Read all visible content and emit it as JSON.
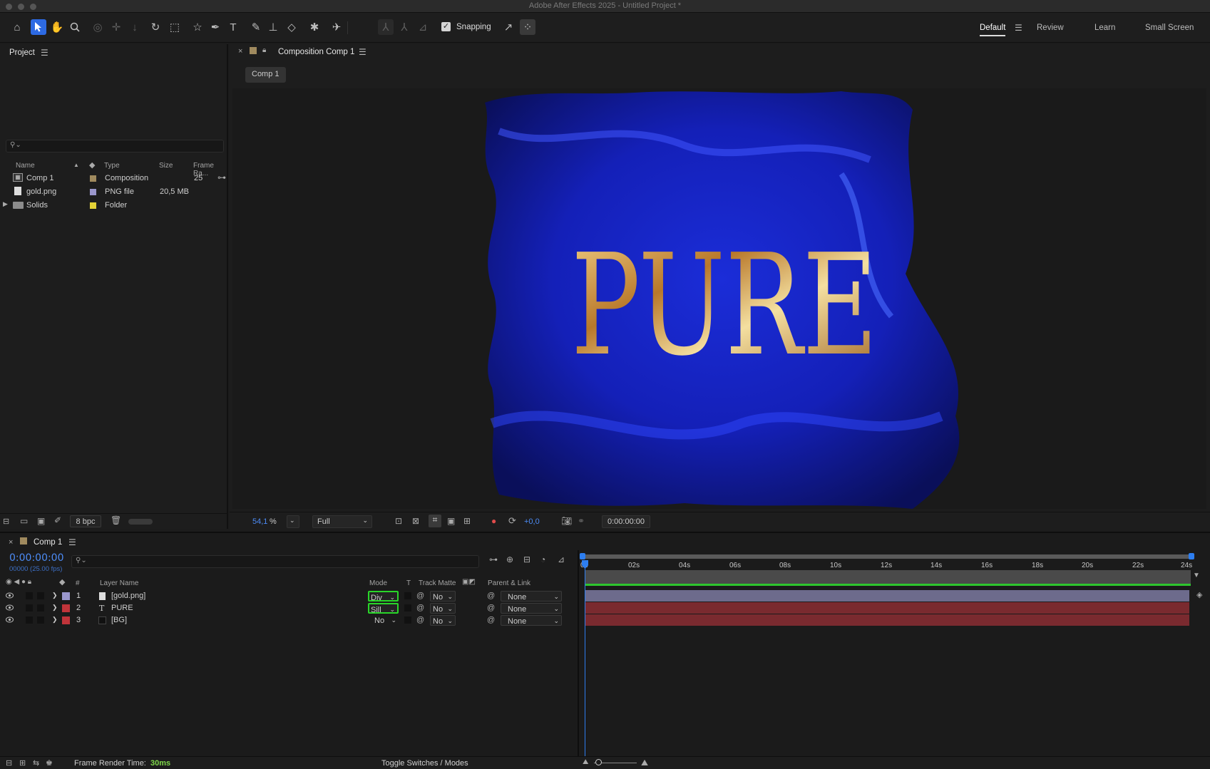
{
  "window": {
    "title": "Adobe After Effects 2025 - Untitled Project *"
  },
  "toolbar": {
    "tools": [
      "home-icon",
      "selection-icon",
      "hand-icon",
      "zoom-icon",
      "orbit-icon",
      "pan-icon",
      "dolly-icon",
      "rotate-icon",
      "region-icon",
      "shape-icon",
      "pen-icon",
      "type-icon",
      "brush-icon",
      "clone-stamp-icon",
      "eraser-icon",
      "roto-brush-icon",
      "puppet-pin-icon"
    ],
    "snapping_label": "Snapping",
    "snapping_checked": true,
    "workspaces": [
      "Default",
      "Review",
      "Learn",
      "Small Screen"
    ],
    "active_workspace": "Default"
  },
  "project": {
    "tab_label": "Project",
    "columns": {
      "name": "Name",
      "type": "Type",
      "size": "Size",
      "frame_rate": "Frame Ra..."
    },
    "items": [
      {
        "name": "Comp 1",
        "type": "Composition",
        "size": "",
        "frame_rate": "25",
        "color": "#a08a5e",
        "icon": "composition-icon"
      },
      {
        "name": "gold.png",
        "type": "PNG file",
        "size": "20,5 MB",
        "frame_rate": "",
        "color": "#9a97cc",
        "icon": "file-icon"
      },
      {
        "name": "Solids",
        "type": "Folder",
        "size": "",
        "frame_rate": "",
        "color": "#e2d136",
        "icon": "folder-icon"
      }
    ],
    "bpc": "8 bpc"
  },
  "viewer": {
    "tab_label": "Composition Comp 1",
    "breadcrumb": "Comp 1",
    "zoom": "54,1",
    "zoom_unit": "%",
    "resolution": "Full",
    "exposure": "+0,0",
    "timecode": "0:00:00:00",
    "comp_text": "PURE"
  },
  "timeline": {
    "tab_label": "Comp 1",
    "timecode": "0:00:00:00",
    "frame_info": "00000 (25.00 fps)",
    "columns": {
      "num": "#",
      "layer_name": "Layer Name",
      "mode": "Mode",
      "t": "T",
      "track_matte": "Track Matte",
      "parent": "Parent & Link"
    },
    "ruler": [
      "0s",
      "02s",
      "04s",
      "06s",
      "08s",
      "10s",
      "12s",
      "14s",
      "16s",
      "18s",
      "20s",
      "22s",
      "24s"
    ],
    "layers": [
      {
        "num": "1",
        "name": "[gold.png]",
        "label_color": "#9a97cc",
        "mode": "Div",
        "matte": "No",
        "parent": "None",
        "bar_color": "#6d6b8c",
        "icon": "file-icon"
      },
      {
        "num": "2",
        "name": "PURE",
        "label_color": "#c0343a",
        "mode": "Sill",
        "matte": "No",
        "parent": "None",
        "bar_color": "#7a2a2f",
        "icon": "text-layer-icon"
      },
      {
        "num": "3",
        "name": "[BG]",
        "label_color": "#c0343a",
        "mode": "No",
        "matte": "No",
        "parent": "None",
        "bar_color": "#7a2a2f",
        "icon": "solid-icon"
      }
    ]
  },
  "status": {
    "render_label": "Frame Render Time:",
    "render_value": "30ms",
    "toggle_label": "Toggle Switches / Modes"
  },
  "colors": {
    "accent": "#2d6ae3",
    "highlight": "#29d629",
    "render_time": "#7fd84a"
  }
}
